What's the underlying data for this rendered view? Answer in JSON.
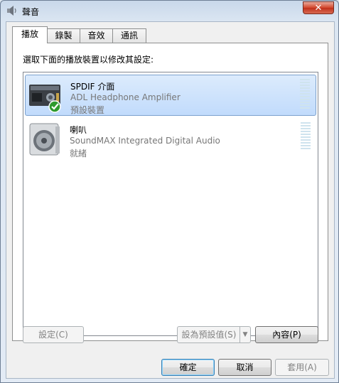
{
  "window": {
    "title": "聲音",
    "close_label": "✕"
  },
  "tabs": [
    {
      "label": "播放",
      "active": true
    },
    {
      "label": "錄製",
      "active": false
    },
    {
      "label": "音效",
      "active": false
    },
    {
      "label": "通訊",
      "active": false
    }
  ],
  "playback": {
    "instruction": "選取下面的播放裝置以修改其設定:",
    "devices": [
      {
        "name": "SPDIF 介面",
        "description": "ADL Headphone Amplifier",
        "status": "預設裝置",
        "icon": "amplifier-icon",
        "default_check": true,
        "selected": true
      },
      {
        "name": "喇叭",
        "description": "SoundMAX Integrated Digital Audio",
        "status": "就緒",
        "icon": "speaker-icon",
        "default_check": false,
        "selected": false
      }
    ],
    "configure_label": "設定(C)",
    "set_default_label": "設為預設值(S)",
    "set_default_arrow": "▼",
    "properties_label": "內容(P)"
  },
  "footer": {
    "ok_label": "確定",
    "cancel_label": "取消",
    "apply_label": "套用(A)"
  },
  "colors": {
    "selection": "#c1dbfc",
    "meter": "#cfe3ee",
    "close": "#c7452c"
  }
}
